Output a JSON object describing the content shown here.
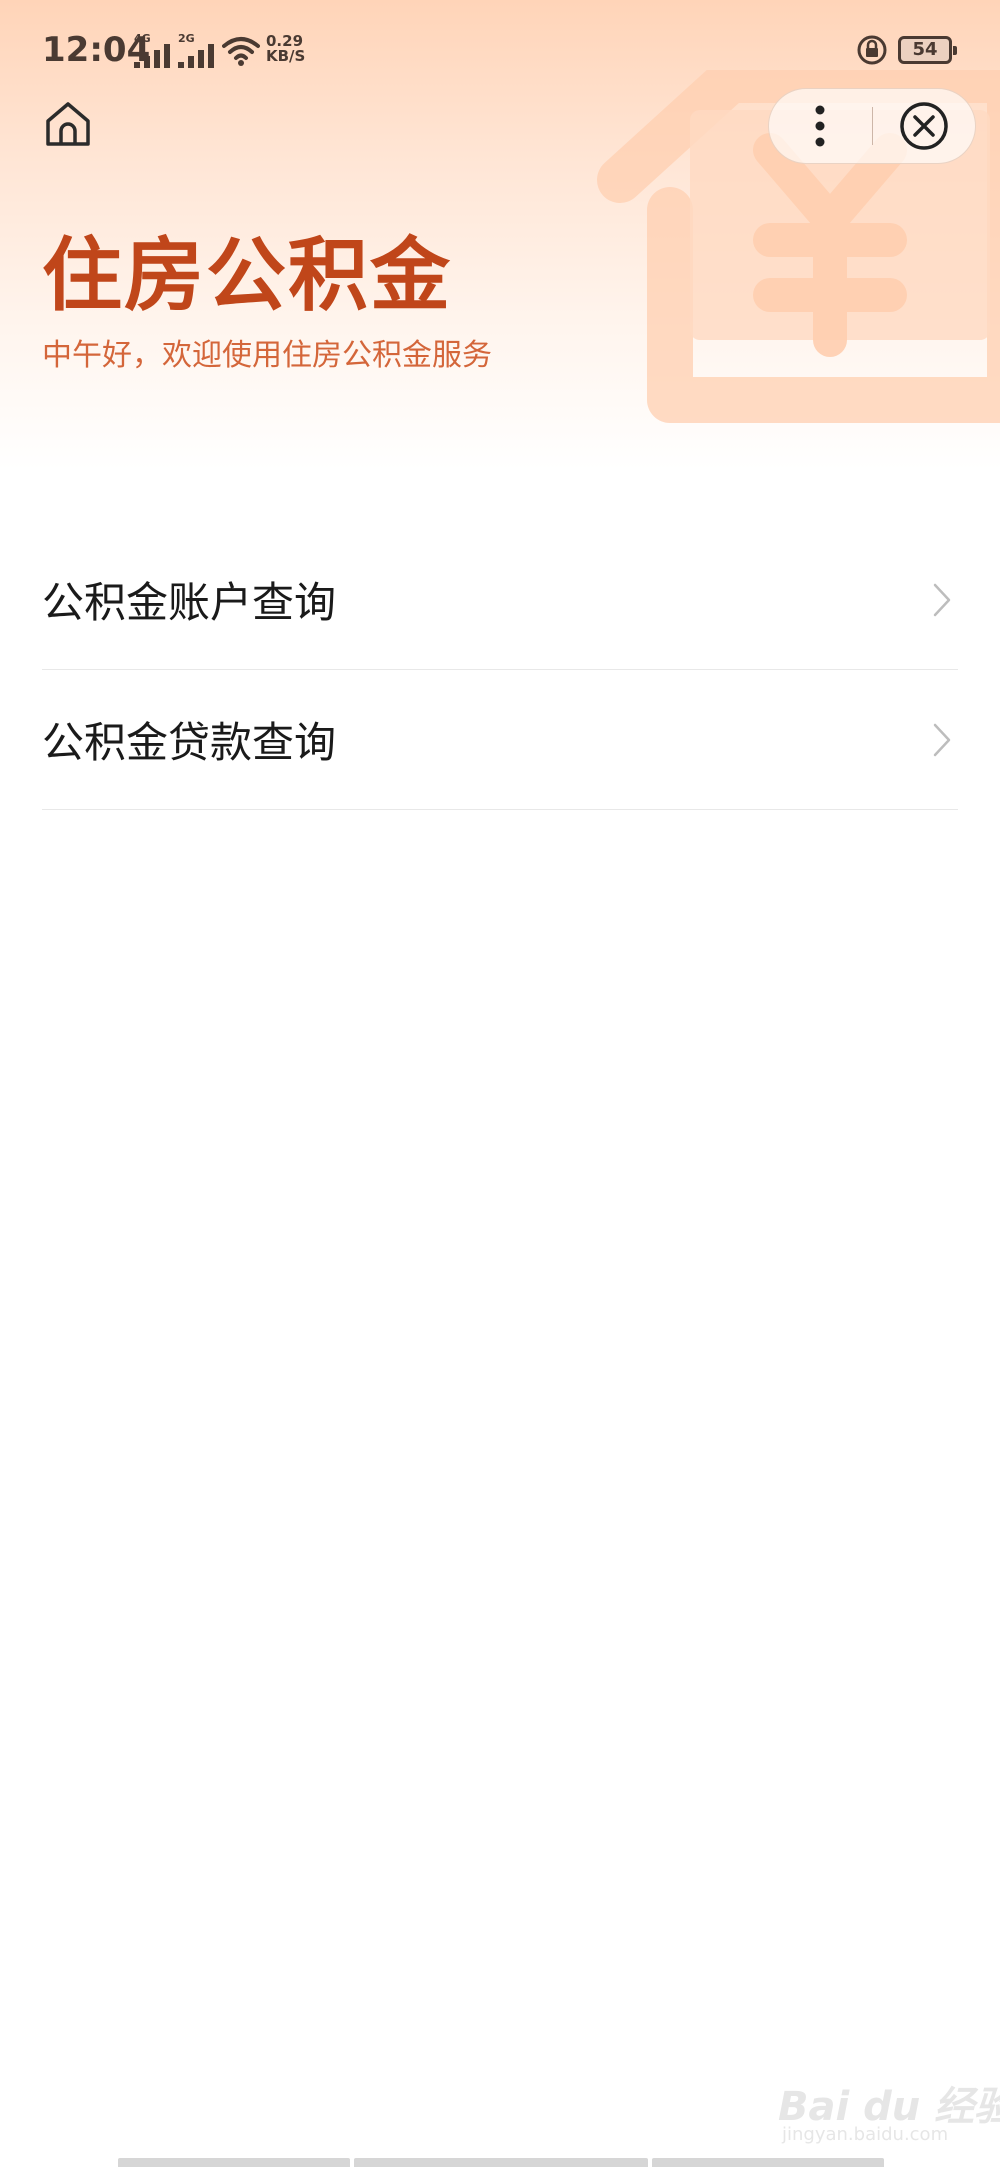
{
  "status_bar": {
    "time": "12:04",
    "signal_1_label": "4G",
    "signal_2_label": "2G",
    "net_speed_value": "0.29",
    "net_speed_unit": "KB/S",
    "battery_level": "54",
    "icons": [
      "signal-icon",
      "wifi-icon",
      "rotation-lock-icon",
      "battery-icon"
    ]
  },
  "nav": {
    "icons": [
      "home-icon",
      "more-icon",
      "close-icon"
    ]
  },
  "header": {
    "title": "住房公积金",
    "subtitle": "中午好，欢迎使用住房公积金服务"
  },
  "menu": {
    "items": [
      {
        "label": "公积金账户查询",
        "icon": "chevron-right-icon"
      },
      {
        "label": "公积金贷款查询",
        "icon": "chevron-right-icon"
      }
    ]
  },
  "watermark": {
    "text": "Bai du 经验",
    "sub": "jingyan.baidu.com"
  },
  "colors": {
    "title": "#c0461a",
    "subtitle": "#d4663a",
    "header_gradient_top": "#ffd4b8",
    "background": "#ffffff",
    "divider": "#e8e8e8"
  }
}
